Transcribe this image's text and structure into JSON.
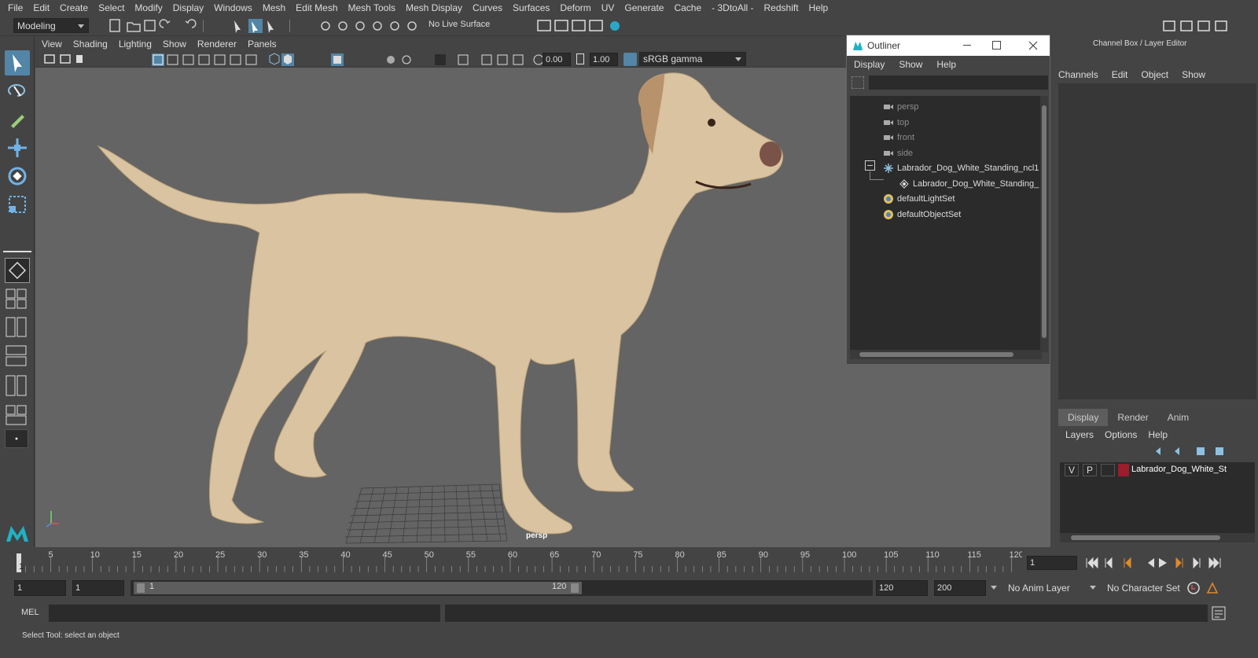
{
  "menubar": [
    "File",
    "Edit",
    "Create",
    "Select",
    "Modify",
    "Display",
    "Windows",
    "Mesh",
    "Edit Mesh",
    "Mesh Tools",
    "Mesh Display",
    "Curves",
    "Surfaces",
    "Deform",
    "UV",
    "Generate",
    "Cache",
    "- 3DtoAll -",
    "Redshift",
    "Help"
  ],
  "shelf": {
    "mode": "Modeling",
    "live_surface": "No Live Surface"
  },
  "viewport": {
    "menu": [
      "View",
      "Shading",
      "Lighting",
      "Show",
      "Renderer",
      "Panels"
    ],
    "exposure": "0.00",
    "gamma": "1.00",
    "colorspace": "sRGB gamma",
    "camera_label": "persp"
  },
  "outliner": {
    "title": "Outliner",
    "menu": [
      "Display",
      "Show",
      "Help"
    ],
    "items": [
      {
        "label": "persp",
        "icon": "camera-icon"
      },
      {
        "label": "top",
        "icon": "camera-icon"
      },
      {
        "label": "front",
        "icon": "camera-icon"
      },
      {
        "label": "side",
        "icon": "camera-icon"
      },
      {
        "label": "Labrador_Dog_White_Standing_ncl1",
        "icon": "group-icon"
      },
      {
        "label": "Labrador_Dog_White_Standing_",
        "icon": "mesh-icon"
      },
      {
        "label": "defaultLightSet",
        "icon": "set-icon"
      },
      {
        "label": "defaultObjectSet",
        "icon": "set-icon"
      }
    ]
  },
  "channelbox": {
    "title": "Channel Box / Layer Editor",
    "menu": [
      "Channels",
      "Edit",
      "Object",
      "Show"
    ],
    "tabs": [
      "Display",
      "Render",
      "Anim"
    ],
    "layer_menu": [
      "Layers",
      "Options",
      "Help"
    ],
    "layer": {
      "v": "V",
      "p": "P",
      "name": "Labrador_Dog_White_St",
      "color": "#9b1c2c"
    }
  },
  "timeline": {
    "ticks": [
      "5",
      "10",
      "15",
      "20",
      "25",
      "30",
      "35",
      "40",
      "45",
      "50",
      "55",
      "60",
      "65",
      "70",
      "75",
      "80",
      "85",
      "90",
      "95",
      "100",
      "105",
      "110",
      "115",
      "120"
    ],
    "start_tick": "1",
    "current_frame": "1"
  },
  "range": {
    "start": "1",
    "start2": "1",
    "slider_start": "1",
    "slider_end": "120",
    "end": "120",
    "end2": "200",
    "anim_layer": "No Anim Layer",
    "char_set": "No Character Set"
  },
  "mel": {
    "label": "MEL"
  },
  "status": {
    "text": "Select Tool: select an object"
  }
}
